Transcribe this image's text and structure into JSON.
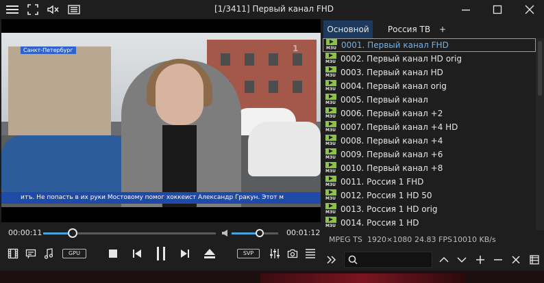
{
  "window": {
    "title": "[1/3411] Первый канал FHD"
  },
  "video": {
    "location_label": "Санкт-Петербург",
    "ticker_text": "итъ.  Не попасть в их руки Мостовому помог хоккеист Александр Гракун.  Этот м"
  },
  "playback": {
    "current_time": "00:00:11",
    "total_time": "00:01:12",
    "progress_percent": 17,
    "volume_percent": 60,
    "gpu_label": "GPU",
    "svp_label": "SVP"
  },
  "tabs": [
    {
      "label": "Основной",
      "active": true
    },
    {
      "label": "Россия ТВ",
      "active": false
    },
    {
      "label": "+",
      "active": false
    }
  ],
  "playlist": {
    "icon_text": "M3U",
    "items": [
      {
        "label": "0001. Первый канал FHD",
        "selected": true
      },
      {
        "label": "0002. Первый канал HD orig",
        "selected": false
      },
      {
        "label": "0003. Первый канал HD",
        "selected": false
      },
      {
        "label": "0004. Первый канал orig",
        "selected": false
      },
      {
        "label": "0005. Первый канал",
        "selected": false
      },
      {
        "label": "0006. Первый канал +2",
        "selected": false
      },
      {
        "label": "0007. Первый канал +4 HD",
        "selected": false
      },
      {
        "label": "0008. Первый канал +4",
        "selected": false
      },
      {
        "label": "0009. Первый канал +6",
        "selected": false
      },
      {
        "label": "0010. Первый канал +8",
        "selected": false
      },
      {
        "label": "0011. Россия 1 FHD",
        "selected": false
      },
      {
        "label": "0012. Россия 1 HD 50",
        "selected": false
      },
      {
        "label": "0013. Россия 1 HD orig",
        "selected": false
      },
      {
        "label": "0014. Россия 1 HD",
        "selected": false
      }
    ]
  },
  "status": {
    "format": "MPEG TS",
    "resolution": "1920×1080",
    "fps": "24.83 FPS",
    "bitrate": "10010 KB/s"
  },
  "search": {
    "placeholder": ""
  }
}
